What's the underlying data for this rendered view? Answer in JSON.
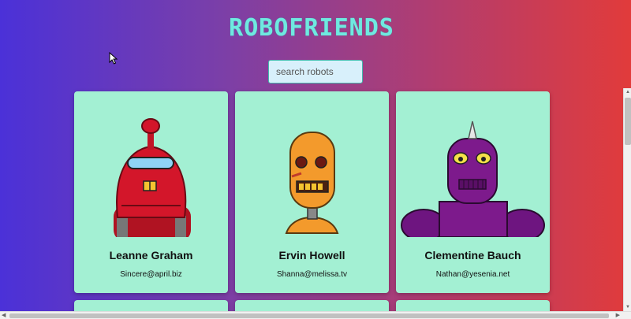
{
  "app": {
    "title": "ROBOFRIENDS"
  },
  "search": {
    "placeholder": "search robots",
    "value": ""
  },
  "robots": [
    {
      "name": "Leanne Graham",
      "email": "Sincere@april.biz",
      "color": "#d3162a"
    },
    {
      "name": "Ervin Howell",
      "email": "Shanna@melissa.tv",
      "color": "#f39a2c"
    },
    {
      "name": "Clementine Bauch",
      "email": "Nathan@yesenia.net",
      "color": "#7d1a8c"
    }
  ],
  "colors": {
    "card_bg": "#a3f0d3",
    "title_color": "#6fe9e0",
    "gradient_start": "#4b31d8",
    "gradient_end": "#e13b3b"
  },
  "icons": {
    "cursor": "arrow-cursor-icon"
  }
}
